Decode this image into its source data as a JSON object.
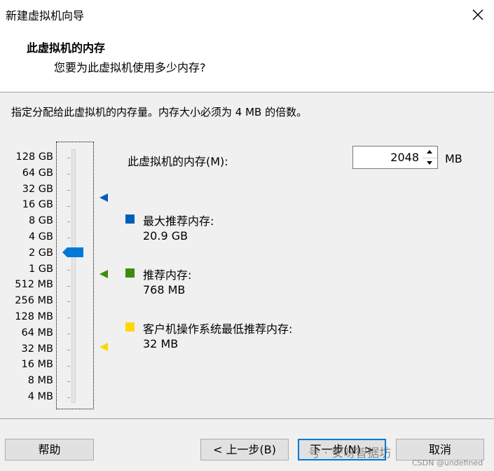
{
  "window": {
    "title": "新建虚拟机向导"
  },
  "header": {
    "title": "此虚拟机的内存",
    "subtitle": "您要为此虚拟机使用多少内存?"
  },
  "instruction": "指定分配给此虚拟机的内存量。内存大小必须为 4 MB 的倍数。",
  "scale_labels": [
    "128 GB",
    "64 GB",
    "32 GB",
    "16 GB",
    "8 GB",
    "4 GB",
    "2 GB",
    "1 GB",
    "512 MB",
    "256 MB",
    "128 MB",
    "64 MB",
    "32 MB",
    "16 MB",
    "8 MB",
    "4 MB"
  ],
  "memory": {
    "label": "此虚拟机的内存(M):",
    "value": "2048",
    "unit": "MB",
    "current_scale_label": "2 GB"
  },
  "legend": [
    {
      "title": "最大推荐内存:",
      "value": "20.9 GB",
      "color": "#005fb8",
      "scale_label": "16 GB"
    },
    {
      "title": "推荐内存:",
      "value": "768 MB",
      "color": "#3c8d0d",
      "scale_label": "768 MB"
    },
    {
      "title": "客户机操作系统最低推荐内存:",
      "value": "32 MB",
      "color": "#ffd700",
      "scale_label": "32 MB"
    }
  ],
  "buttons": {
    "help": "帮助",
    "back": "< 上一步(B)",
    "next": "下一步(N) >",
    "cancel": "取消"
  },
  "watermark": {
    "main": "号 · 安呀智据坊",
    "sub": "CSDN @undefined"
  },
  "icons": {
    "close": "close-icon",
    "spin_up": "chevron-up-icon",
    "spin_down": "chevron-down-icon",
    "thumb": "slider-thumb-icon"
  }
}
